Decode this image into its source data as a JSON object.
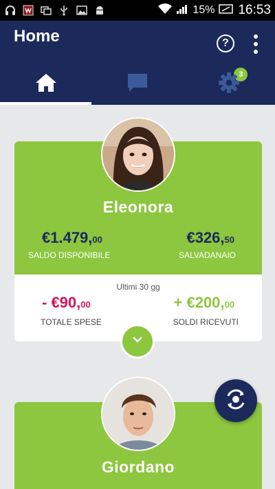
{
  "status_bar": {
    "battery_percent": "15%",
    "time": "16:53"
  },
  "header": {
    "title": "Home",
    "tabs": [
      {
        "name": "home",
        "icon": "home-icon",
        "active": true
      },
      {
        "name": "messages",
        "icon": "chat-icon",
        "badge": "3"
      },
      {
        "name": "settings",
        "icon": "gear-icon"
      }
    ]
  },
  "cards": [
    {
      "name": "Eleonora",
      "saldo_main": "€1.479,",
      "saldo_cents": "00",
      "saldo_label": "SALDO DISPONIBILE",
      "salvadanaio_main": "€326,",
      "salvadanaio_cents": "50",
      "salvadanaio_label": "SALVADANAIO",
      "period": "Ultimi 30 gg",
      "spese_main": "- €90,",
      "spese_cents": "00",
      "spese_label": "TOTALE SPESE",
      "ricevuti_main": "+ €200,",
      "ricevuti_cents": "00",
      "ricevuti_label": "SOLDI RICEVUTI"
    },
    {
      "name": "Giordano"
    }
  ],
  "colors": {
    "header": "#1b2a5b",
    "green": "#8dc63f",
    "expense": "#d4145a"
  }
}
